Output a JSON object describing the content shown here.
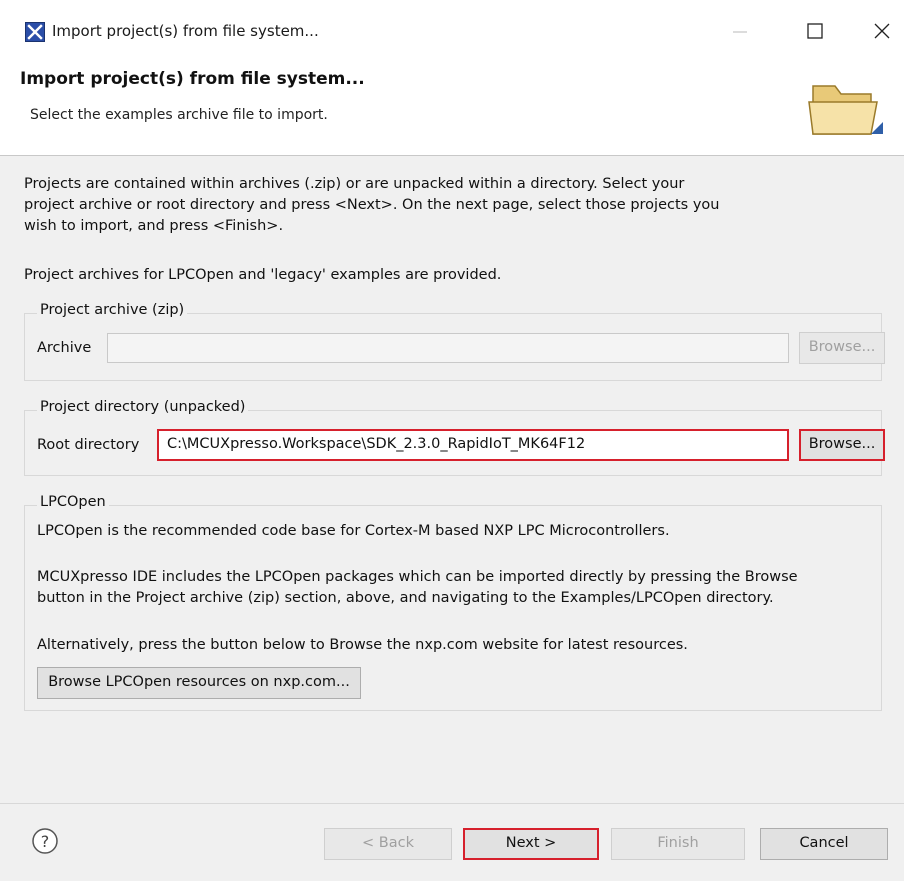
{
  "window": {
    "title": "Import project(s) from file system...",
    "controls": {
      "minimize": "minimize",
      "maximize": "maximize",
      "close": "close"
    }
  },
  "header": {
    "title": "Import project(s) from file system...",
    "description": "Select the examples archive file to import."
  },
  "intro": {
    "paragraph1_line1": "Projects are contained within archives (.zip) or are unpacked within a directory. Select your",
    "paragraph1_line2": "project archive or root directory and press <Next>. On the next page, select those projects you",
    "paragraph1_line3": "wish to import, and press <Finish>.",
    "paragraph2": "Project archives for LPCOpen and 'legacy' examples are provided."
  },
  "archive_group": {
    "legend": "Project archive (zip)",
    "label": "Archive",
    "value": "",
    "browse_label": "Browse..."
  },
  "directory_group": {
    "legend": "Project directory (unpacked)",
    "label": "Root directory",
    "value": "C:\\MCUXpresso.Workspace\\SDK_2.3.0_RapidIoT_MK64F12",
    "browse_label": "Browse..."
  },
  "lpcopen_group": {
    "legend": "LPCOpen",
    "text1": "LPCOpen is the recommended code base for Cortex-M based NXP LPC Microcontrollers.",
    "text2_line1": "MCUXpresso IDE includes the LPCOpen packages which can be imported directly by pressing the Browse",
    "text2_line2": "button in the Project archive (zip) section, above, and navigating to the Examples/LPCOpen directory.",
    "text3": "Alternatively, press the button below to Browse the nxp.com website for latest resources.",
    "button_label": "Browse LPCOpen resources on nxp.com..."
  },
  "footer": {
    "back_label": "< Back",
    "next_label": "Next >",
    "finish_label": "Finish",
    "cancel_label": "Cancel"
  },
  "colors": {
    "highlight": "#d6202c",
    "dialog_background": "#f0f0f0",
    "app_icon": "#2b4ea8"
  },
  "icons": {
    "app": "mcuxpresso-x-icon",
    "banner": "open-folder-icon",
    "help": "question-circle-icon"
  }
}
